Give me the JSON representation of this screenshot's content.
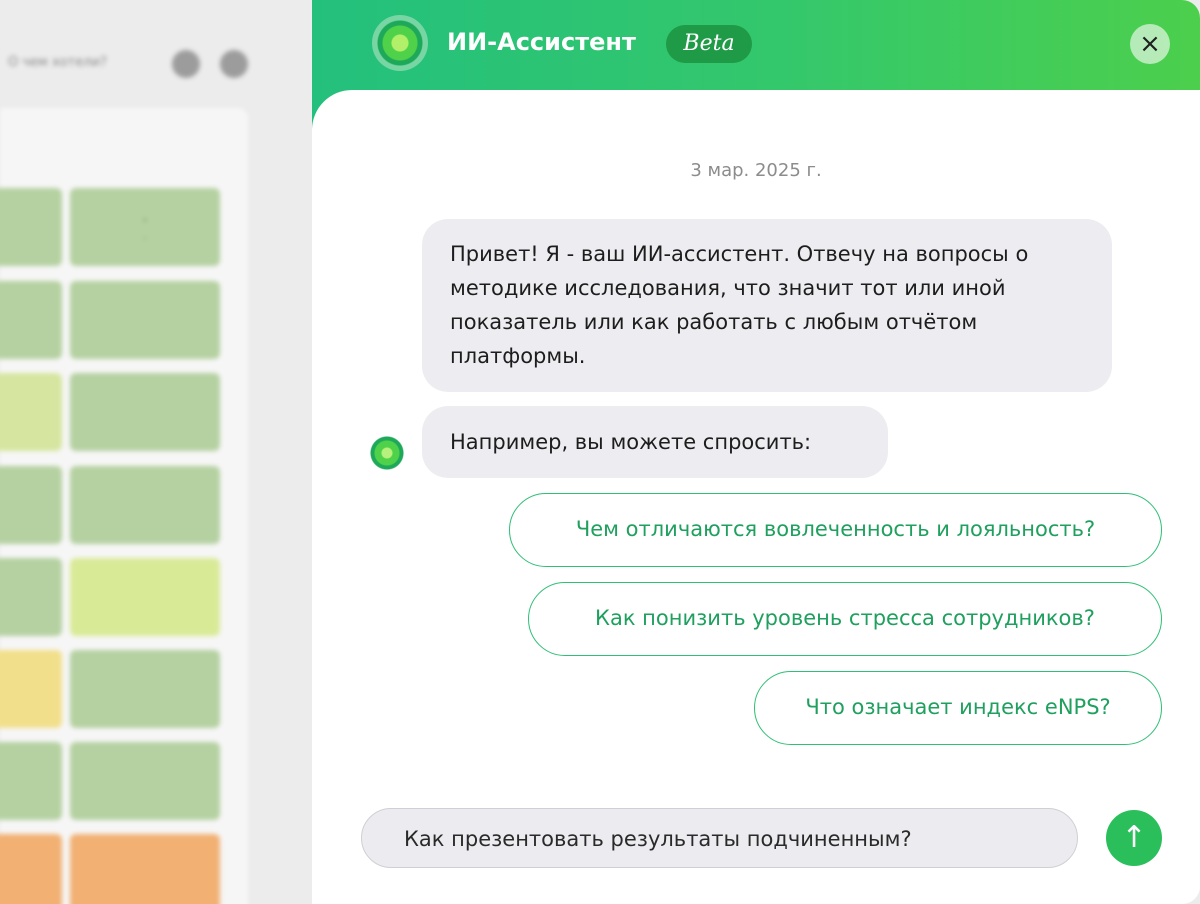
{
  "header": {
    "title": "ИИ-Ассистент",
    "badge": "Beta",
    "close_label": "×"
  },
  "chat": {
    "date": "3 мар. 2025 г.",
    "messages": [
      {
        "role": "assistant",
        "text": "Привет! Я - ваш ИИ-ассистент. Отвечу на вопросы о методике исследования, что значит тот или иной показатель или как работать с любым отчётом платформы."
      },
      {
        "role": "assistant",
        "text": "Например, вы можете спросить:"
      }
    ],
    "suggestions": [
      "Чем отличаются вовлеченность и лояльность?",
      "Как понизить уровень стресса сотрудников?",
      "Что означает индекс eNPS?"
    ]
  },
  "composer": {
    "value": "Как презентовать результаты подчиненным?",
    "send_label": "↑"
  },
  "icons": {
    "logo": "assistant-logo-icon",
    "avatar": "assistant-avatar-icon",
    "close": "close-icon",
    "send": "arrow-up-icon"
  },
  "colors": {
    "accent": "#2bbf5c",
    "header_gradient_start": "#23c07d",
    "header_gradient_end": "#4ccf4c",
    "bubble": "#ededf1",
    "suggestion_text": "#1fa05e"
  }
}
